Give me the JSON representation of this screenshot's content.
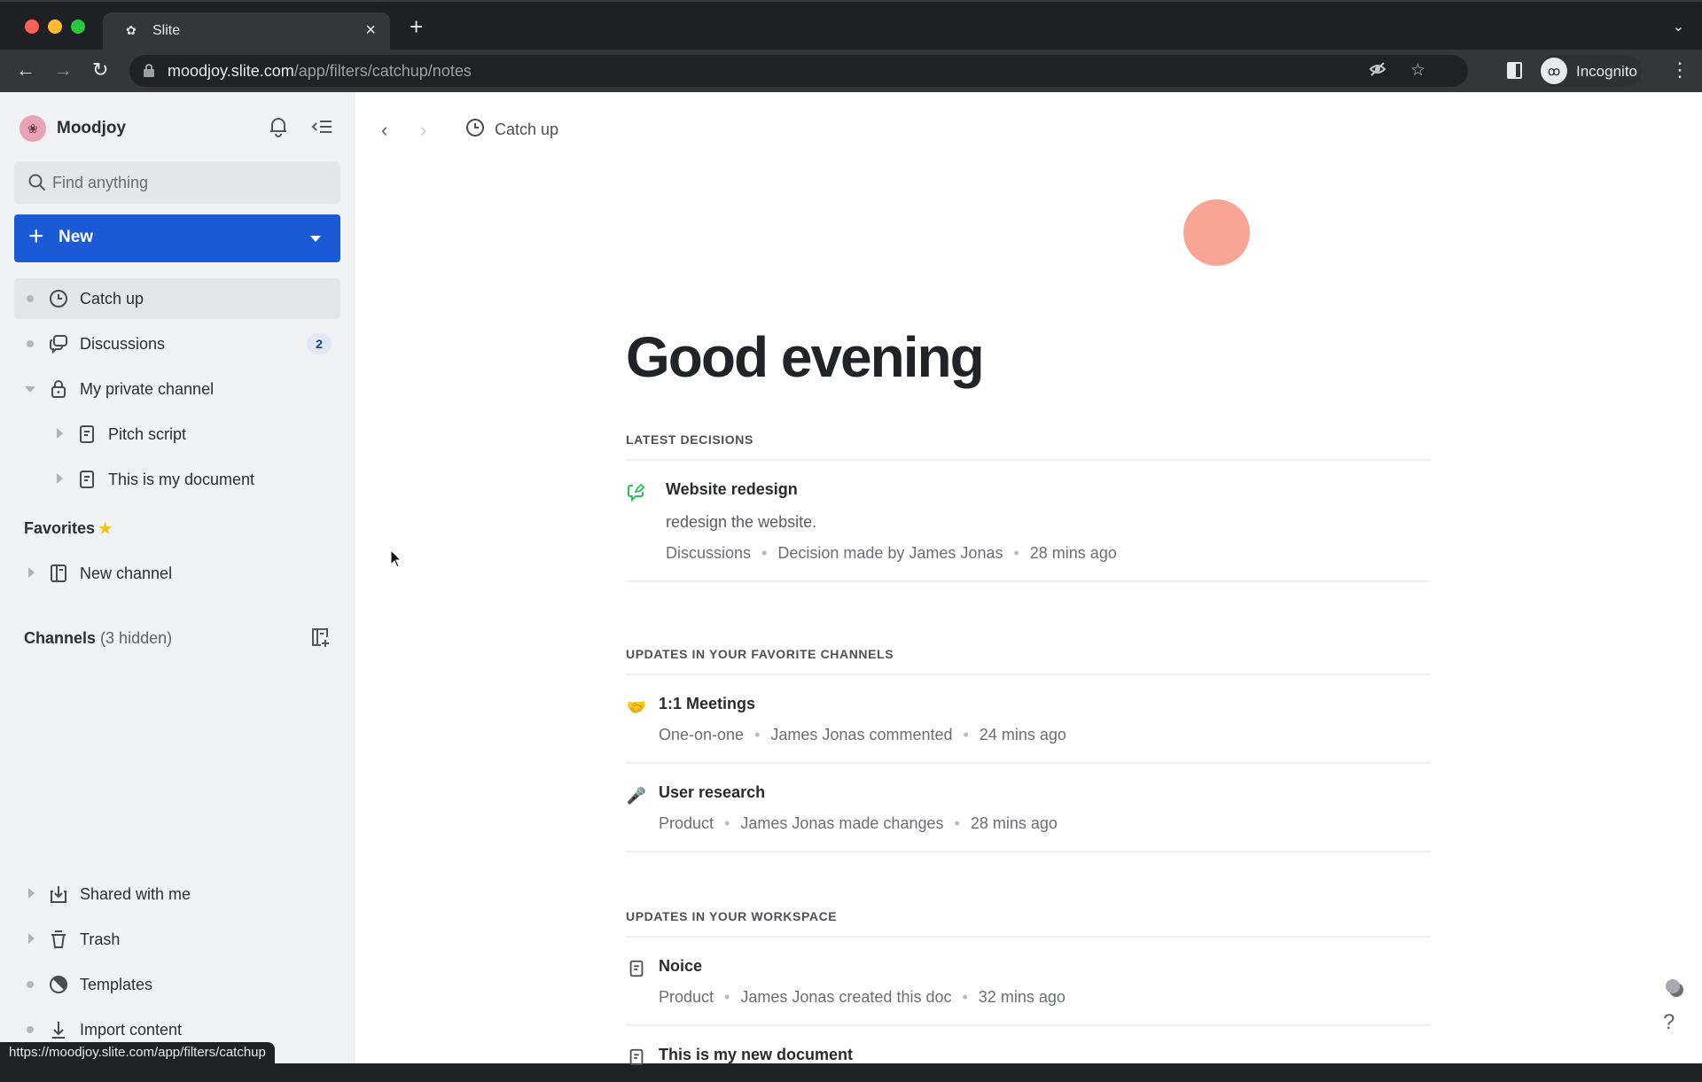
{
  "browser": {
    "tab_title": "Slite",
    "url_host": "moodjoy.slite.com",
    "url_path": "/app/filters/catchup/notes",
    "profile_label": "Incognito",
    "status_url": "https://moodjoy.slite.com/app/filters/catchup",
    "icons": [
      "close-icon",
      "plus-icon",
      "back-icon",
      "forward-icon",
      "reload-icon",
      "lock-icon",
      "eye-off-icon",
      "star-icon",
      "side-panel-icon",
      "incognito-icon",
      "more-icon",
      "chevron-down-icon"
    ]
  },
  "sidebar": {
    "workspace_name": "Moodjoy",
    "search_placeholder": "Find anything",
    "new_button_label": "New",
    "items": [
      {
        "label": "Catch up",
        "icon": "clock-icon",
        "active": true
      },
      {
        "label": "Discussions",
        "icon": "chat-bubbles-icon",
        "badge": "2"
      },
      {
        "label": "My private channel",
        "icon": "lock-icon",
        "expanded": true
      },
      {
        "label": "Pitch script",
        "icon": "document-icon"
      },
      {
        "label": "This is my document",
        "icon": "document-icon"
      }
    ],
    "favorites": {
      "title": "Favorites",
      "items": [
        {
          "label": "New channel",
          "icon": "channel-icon"
        }
      ]
    },
    "channels": {
      "title": "Channels",
      "hidden_note": "(3 hidden)"
    },
    "bottom_items": [
      {
        "label": "Shared with me",
        "icon": "inbox-download-icon"
      },
      {
        "label": "Trash",
        "icon": "trash-icon"
      },
      {
        "label": "Templates",
        "icon": "templates-icon"
      },
      {
        "label": "Import content",
        "icon": "import-icon"
      }
    ]
  },
  "main": {
    "breadcrumb_label": "Catch up",
    "greeting": "Good evening",
    "accent_avatar_color": "#f9a596",
    "sections": [
      {
        "title": "Latest decisions",
        "items": [
          {
            "icon": "decision-icon",
            "title": "Website redesign",
            "description": "redesign the website.",
            "channel": "Discussions",
            "action": "Decision made by James Jonas",
            "time": "28 mins ago"
          }
        ]
      },
      {
        "title": "Updates in your favorite channels",
        "items": [
          {
            "icon": "handshake-emoji-icon",
            "title": "1:1 Meetings",
            "channel": "One-on-one",
            "action": "James Jonas commented",
            "time": "24 mins ago"
          },
          {
            "icon": "microphone-emoji-icon",
            "title": "User research",
            "channel": "Product",
            "action": "James Jonas made changes",
            "time": "28 mins ago"
          }
        ]
      },
      {
        "title": "Updates in your workspace",
        "items": [
          {
            "icon": "document-icon",
            "title": "Noice",
            "channel": "Product",
            "action": "James Jonas created this doc",
            "time": "32 mins ago"
          },
          {
            "icon": "document-icon",
            "title": "This is my new document"
          }
        ]
      }
    ],
    "help_label": "?"
  }
}
